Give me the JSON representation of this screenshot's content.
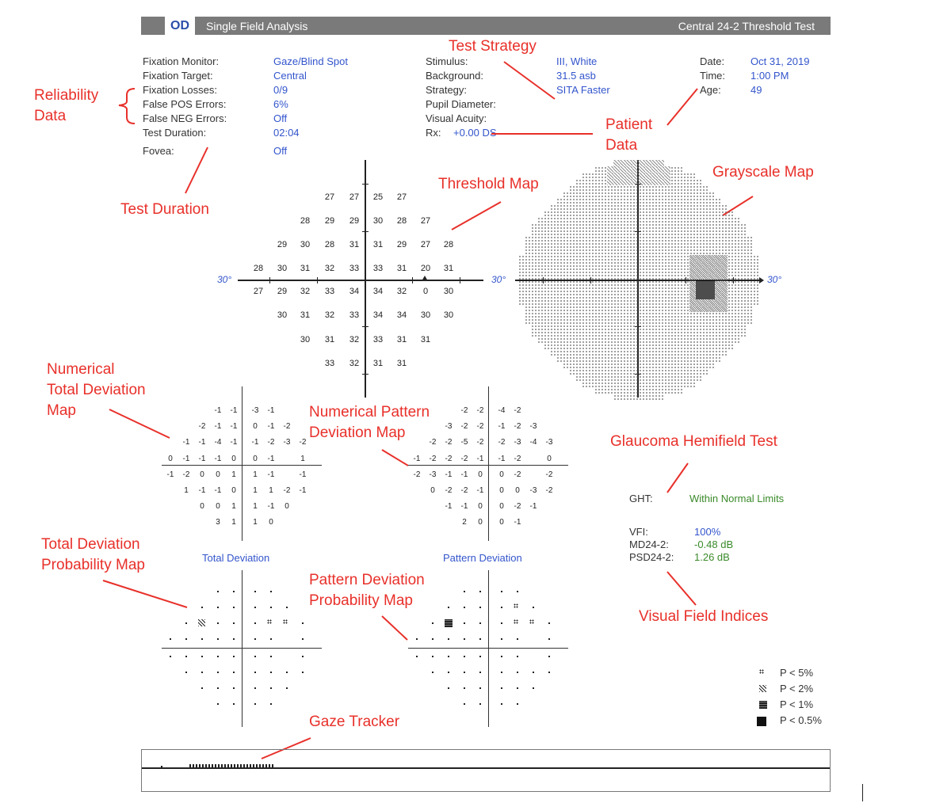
{
  "header": {
    "eye": "OD",
    "title": "Single Field Analysis",
    "test_name": "Central 24-2 Threshold Test"
  },
  "reliability": [
    {
      "label": "Fixation Monitor:",
      "value": "Gaze/Blind Spot"
    },
    {
      "label": "Fixation Target:",
      "value": "Central"
    },
    {
      "label": "Fixation Losses:",
      "value": "0/9"
    },
    {
      "label": "False POS Errors:",
      "value": "6%"
    },
    {
      "label": "False NEG Errors:",
      "value": "Off"
    },
    {
      "label": "Test Duration:",
      "value": "02:04"
    },
    {
      "label": "Fovea:",
      "value": "Off"
    }
  ],
  "stimulus": [
    {
      "label": "Stimulus:",
      "value": "III, White"
    },
    {
      "label": "Background:",
      "value": "31.5 asb"
    },
    {
      "label": "Strategy:",
      "value": "SITA Faster"
    },
    {
      "label": "Pupil Diameter:",
      "value": ""
    },
    {
      "label": "Visual Acuity:",
      "value": ""
    }
  ],
  "rx": {
    "label": "Rx:",
    "value": "+0.00 DS"
  },
  "patient": [
    {
      "label": "Date:",
      "value": "Oct 31, 2019"
    },
    {
      "label": "Time:",
      "value": "1:00 PM"
    },
    {
      "label": "Age:",
      "value": "49"
    }
  ],
  "annotations": {
    "test_strategy": "Test Strategy",
    "reliability_1": "Reliability",
    "reliability_2": "Data",
    "patient_1": "Patient",
    "patient_2": "Data",
    "test_duration": "Test Duration",
    "threshold_map": "Threshold Map",
    "grayscale_map": "Grayscale Map",
    "ntd_1": "Numerical",
    "ntd_2": "Total Deviation",
    "ntd_3": "Map",
    "npd_1": "Numerical Pattern",
    "npd_2": "Deviation Map",
    "ght": "Glaucoma Hemifield Test",
    "tdp_1": "Total Deviation",
    "tdp_2": "Probability Map",
    "pdp_1": "Pattern Deviation",
    "pdp_2": "Probability Map",
    "vfi": "Visual Field Indices",
    "gaze": "Gaze Tracker"
  },
  "axis_label": "30°",
  "threshold_rows": [
    [
      "27",
      "27",
      "25",
      "27"
    ],
    [
      "28",
      "29",
      "29",
      "30",
      "28",
      "27"
    ],
    [
      "29",
      "30",
      "28",
      "31",
      "31",
      "29",
      "27",
      "28"
    ],
    [
      "28",
      "30",
      "31",
      "32",
      "33",
      "33",
      "31",
      "20",
      "31"
    ],
    [
      "27",
      "29",
      "32",
      "33",
      "34",
      "34",
      "32",
      "0",
      "30"
    ],
    [
      "30",
      "31",
      "32",
      "33",
      "34",
      "34",
      "30",
      "30"
    ],
    [
      "30",
      "31",
      "32",
      "33",
      "31",
      "31"
    ],
    [
      "33",
      "32",
      "31",
      "31"
    ]
  ],
  "total_dev_rows": [
    [
      "-1",
      "-1",
      "-3",
      "-1"
    ],
    [
      "-2",
      "-1",
      "-1",
      "0",
      "-1",
      "-2"
    ],
    [
      "-1",
      "-1",
      "-4",
      "-1",
      "-1",
      "-2",
      "-3",
      "-2"
    ],
    [
      "0",
      "-1",
      "-1",
      "-1",
      "0",
      "0",
      "-1",
      "",
      "1"
    ],
    [
      "-1",
      "-2",
      "0",
      "0",
      "1",
      "1",
      "-1",
      "",
      "-1"
    ],
    [
      "1",
      "-1",
      "-1",
      "0",
      "1",
      "1",
      "-2",
      "-1"
    ],
    [
      "0",
      "0",
      "1",
      "1",
      "-1",
      "0"
    ],
    [
      "3",
      "1",
      "1",
      "0"
    ]
  ],
  "pattern_dev_rows": [
    [
      "-2",
      "-2",
      "-4",
      "-2"
    ],
    [
      "-3",
      "-2",
      "-2",
      "-1",
      "-2",
      "-3"
    ],
    [
      "-2",
      "-2",
      "-5",
      "-2",
      "-2",
      "-3",
      "-4",
      "-3"
    ],
    [
      "-1",
      "-2",
      "-2",
      "-2",
      "-1",
      "-1",
      "-2",
      "",
      "0"
    ],
    [
      "-2",
      "-3",
      "-1",
      "-1",
      "0",
      "0",
      "-2",
      "",
      "-2"
    ],
    [
      "0",
      "-2",
      "-2",
      "-1",
      "0",
      "0",
      "-3",
      "-2"
    ],
    [
      "-1",
      "-1",
      "0",
      "0",
      "-2",
      "-1"
    ],
    [
      "2",
      "0",
      "0",
      "-1"
    ]
  ],
  "total_dev_title": "Total Deviation",
  "pattern_dev_title": "Pattern Deviation",
  "ght": {
    "label": "GHT:",
    "value": "Within Normal Limits"
  },
  "indices": [
    {
      "label": "VFI:",
      "value": "100%",
      "color": "#3355cc"
    },
    {
      "label": "MD24-2:",
      "value": "-0.48 dB",
      "color": "#3a8a2a"
    },
    {
      "label": "PSD24-2:",
      "value": "1.26 dB",
      "color": "#3a8a2a"
    }
  ],
  "legend": [
    {
      "symbol": "p5",
      "label": "P < 5%"
    },
    {
      "symbol": "p2",
      "label": "P < 2%"
    },
    {
      "symbol": "p1",
      "label": "P < 1%"
    },
    {
      "symbol": "p05",
      "label": "P < 0.5%"
    }
  ],
  "colors": {
    "annotation": "#e8302a",
    "value_blue": "#3355cc",
    "value_green": "#3a8a2a"
  }
}
